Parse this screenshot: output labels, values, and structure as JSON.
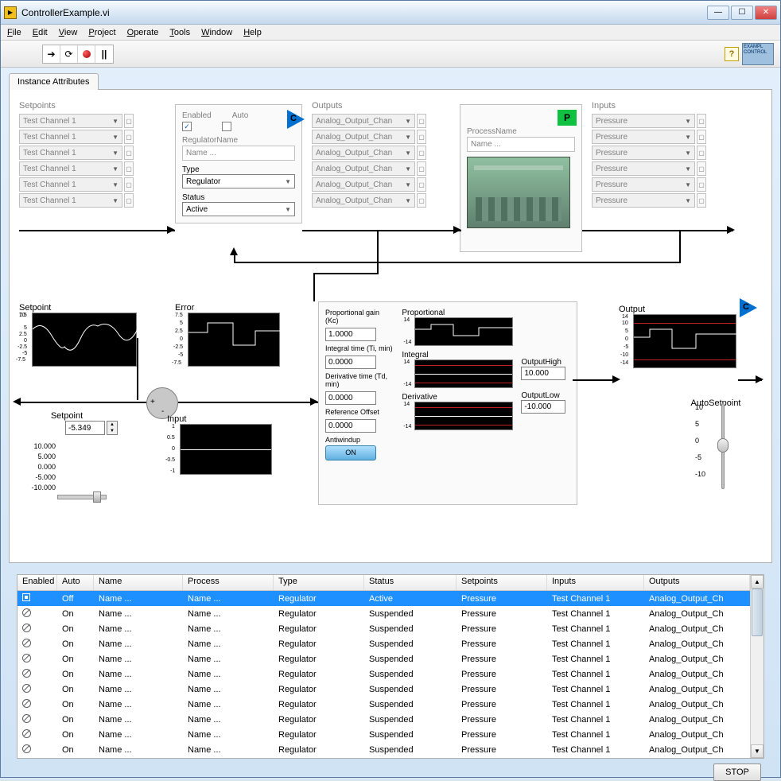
{
  "window": {
    "title": "ControllerExample.vi"
  },
  "menu": [
    "File",
    "Edit",
    "View",
    "Project",
    "Operate",
    "Tools",
    "Window",
    "Help"
  ],
  "toolbar_right": {
    "exampl": "EXAMPL",
    "control": "CONTROL"
  },
  "tab": "Instance Attributes",
  "setpoints": {
    "label": "Setpoints",
    "items": [
      "Test Channel 1",
      "Test Channel 1",
      "Test Channel 1",
      "Test Channel 1",
      "Test Channel 1",
      "Test Channel 1"
    ]
  },
  "regulator": {
    "enabled_label": "Enabled",
    "auto_label": "Auto",
    "enabled_checked": true,
    "auto_checked": false,
    "name_label": "RegulatorName",
    "name_value": "Name ...",
    "type_label": "Type",
    "type_value": "Regulator",
    "status_label": "Status",
    "status_value": "Active",
    "badge": "C"
  },
  "outputs": {
    "label": "Outputs",
    "items": [
      "Analog_Output_Chan",
      "Analog_Output_Chan",
      "Analog_Output_Chan",
      "Analog_Output_Chan",
      "Analog_Output_Chan",
      "Analog_Output_Chan"
    ]
  },
  "process": {
    "label": "ProcessName",
    "value": "Name ...",
    "badge": "P"
  },
  "inputs": {
    "label": "Inputs",
    "items": [
      "Pressure",
      "Pressure",
      "Pressure",
      "Pressure",
      "Pressure",
      "Pressure"
    ]
  },
  "charts": {
    "setpoint_label": "Setpoint",
    "error_label": "Error",
    "input_label": "Input",
    "output_label": "Output",
    "setpoint_ctrl_label": "Setpoint",
    "setpoint_value": "-5.349",
    "autosetpoint_label": "AutoSetpoint"
  },
  "setpoint_scale": [
    "10.000",
    "5.000",
    "0.000",
    "-5.000",
    "-10.000"
  ],
  "slider_scale": [
    "10",
    "5",
    "0",
    "-5",
    "-10"
  ],
  "pid": {
    "kc_label": "Proportional gain (Kc)",
    "kc": "1.0000",
    "ti_label": "Integral time (Ti, min)",
    "ti": "0.0000",
    "td_label": "Derivative time (Td, min)",
    "td": "0.0000",
    "ref_label": "Reference Offset",
    "ref": "0.0000",
    "aw_label": "Antiwindup",
    "aw_btn": "ON",
    "prop_label": "Proportional",
    "int_label": "Integral",
    "der_label": "Derivative"
  },
  "limits": {
    "high_label": "OutputHigh",
    "high": "10.000",
    "low_label": "OutputLow",
    "low": "-10.000"
  },
  "out_badge": "C",
  "table": {
    "headers": [
      "Enabled",
      "Auto",
      "Name",
      "Process",
      "Type",
      "Status",
      "Setpoints",
      "Inputs",
      "Outputs"
    ],
    "rows": [
      {
        "sel": true,
        "auto": "Off",
        "name": "Name ...",
        "process": "Name ...",
        "type": "Regulator",
        "status": "Active",
        "setpoints": "Pressure",
        "inputs": "Test Channel 1",
        "outputs": "Analog_Output_Ch"
      },
      {
        "sel": false,
        "auto": "On",
        "name": "Name ...",
        "process": "Name ...",
        "type": "Regulator",
        "status": "Suspended",
        "setpoints": "Pressure",
        "inputs": "Test Channel 1",
        "outputs": "Analog_Output_Ch"
      },
      {
        "sel": false,
        "auto": "On",
        "name": "Name ...",
        "process": "Name ...",
        "type": "Regulator",
        "status": "Suspended",
        "setpoints": "Pressure",
        "inputs": "Test Channel 1",
        "outputs": "Analog_Output_Ch"
      },
      {
        "sel": false,
        "auto": "On",
        "name": "Name ...",
        "process": "Name ...",
        "type": "Regulator",
        "status": "Suspended",
        "setpoints": "Pressure",
        "inputs": "Test Channel 1",
        "outputs": "Analog_Output_Ch"
      },
      {
        "sel": false,
        "auto": "On",
        "name": "Name ...",
        "process": "Name ...",
        "type": "Regulator",
        "status": "Suspended",
        "setpoints": "Pressure",
        "inputs": "Test Channel 1",
        "outputs": "Analog_Output_Ch"
      },
      {
        "sel": false,
        "auto": "On",
        "name": "Name ...",
        "process": "Name ...",
        "type": "Regulator",
        "status": "Suspended",
        "setpoints": "Pressure",
        "inputs": "Test Channel 1",
        "outputs": "Analog_Output_Ch"
      },
      {
        "sel": false,
        "auto": "On",
        "name": "Name ...",
        "process": "Name ...",
        "type": "Regulator",
        "status": "Suspended",
        "setpoints": "Pressure",
        "inputs": "Test Channel 1",
        "outputs": "Analog_Output_Ch"
      },
      {
        "sel": false,
        "auto": "On",
        "name": "Name ...",
        "process": "Name ...",
        "type": "Regulator",
        "status": "Suspended",
        "setpoints": "Pressure",
        "inputs": "Test Channel 1",
        "outputs": "Analog_Output_Ch"
      },
      {
        "sel": false,
        "auto": "On",
        "name": "Name ...",
        "process": "Name ...",
        "type": "Regulator",
        "status": "Suspended",
        "setpoints": "Pressure",
        "inputs": "Test Channel 1",
        "outputs": "Analog_Output_Ch"
      },
      {
        "sel": false,
        "auto": "On",
        "name": "Name ...",
        "process": "Name ...",
        "type": "Regulator",
        "status": "Suspended",
        "setpoints": "Pressure",
        "inputs": "Test Channel 1",
        "outputs": "Analog_Output_Ch"
      },
      {
        "sel": false,
        "auto": "On",
        "name": "Name ...",
        "process": "Name ...",
        "type": "Regulator",
        "status": "Suspended",
        "setpoints": "Pressure",
        "inputs": "Test Channel 1",
        "outputs": "Analog_Output_Ch"
      }
    ]
  },
  "stop": "STOP",
  "chart_data": [
    {
      "type": "line",
      "title": "Setpoint",
      "ylim": [
        -7.5,
        10
      ],
      "yticks": [
        10,
        7.5,
        5,
        2.5,
        0,
        -2.5,
        -5,
        -7.5
      ]
    },
    {
      "type": "line",
      "title": "Error",
      "ylim": [
        -7.5,
        7.5
      ],
      "yticks": [
        7.5,
        5,
        2.5,
        0,
        -2.5,
        -5,
        -7.5
      ]
    },
    {
      "type": "line",
      "title": "Input",
      "ylim": [
        -1,
        1
      ],
      "yticks": [
        1,
        0.5,
        0,
        -0.5,
        -1
      ]
    },
    {
      "type": "line",
      "title": "Output",
      "ylim": [
        -14,
        14
      ],
      "yticks": [
        14,
        10,
        5,
        0,
        -5,
        -10,
        -14
      ]
    },
    {
      "type": "line",
      "title": "Proportional",
      "ylim": [
        -14,
        14
      ]
    },
    {
      "type": "line",
      "title": "Integral",
      "ylim": [
        -14,
        14
      ]
    },
    {
      "type": "line",
      "title": "Derivative",
      "ylim": [
        -14,
        14
      ]
    }
  ]
}
